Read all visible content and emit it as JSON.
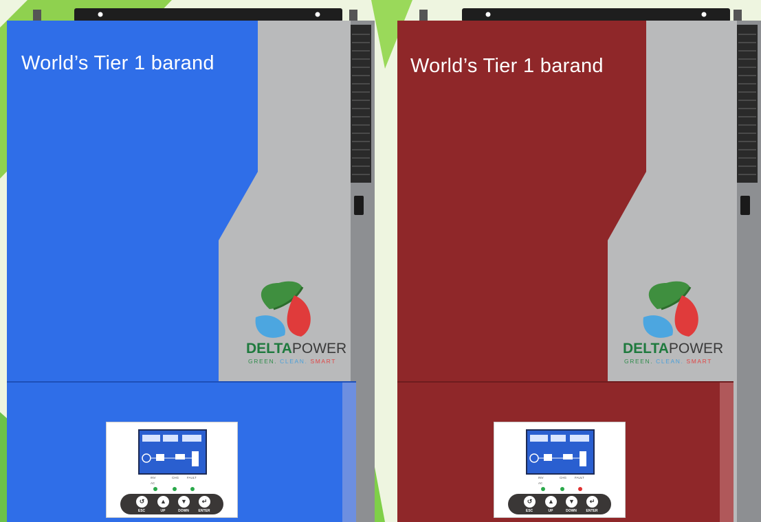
{
  "tagline": "World’s Tier 1 barand",
  "brand": {
    "part1": "DELTA",
    "part2": "POWER"
  },
  "slogan": {
    "green": "GREEN.",
    "clean": "CLEAN.",
    "smart": "SMART"
  },
  "indicators": {
    "inv": "INV",
    "ac": "AC",
    "chg": "CHG",
    "fault": "FAULT"
  },
  "buttons": {
    "esc": "ESC",
    "up": "UP",
    "down": "DOWN",
    "enter": "ENTER"
  },
  "units": [
    {
      "name": "blue",
      "color": "#2f6ee8"
    },
    {
      "name": "red",
      "color": "#8f2729"
    }
  ]
}
